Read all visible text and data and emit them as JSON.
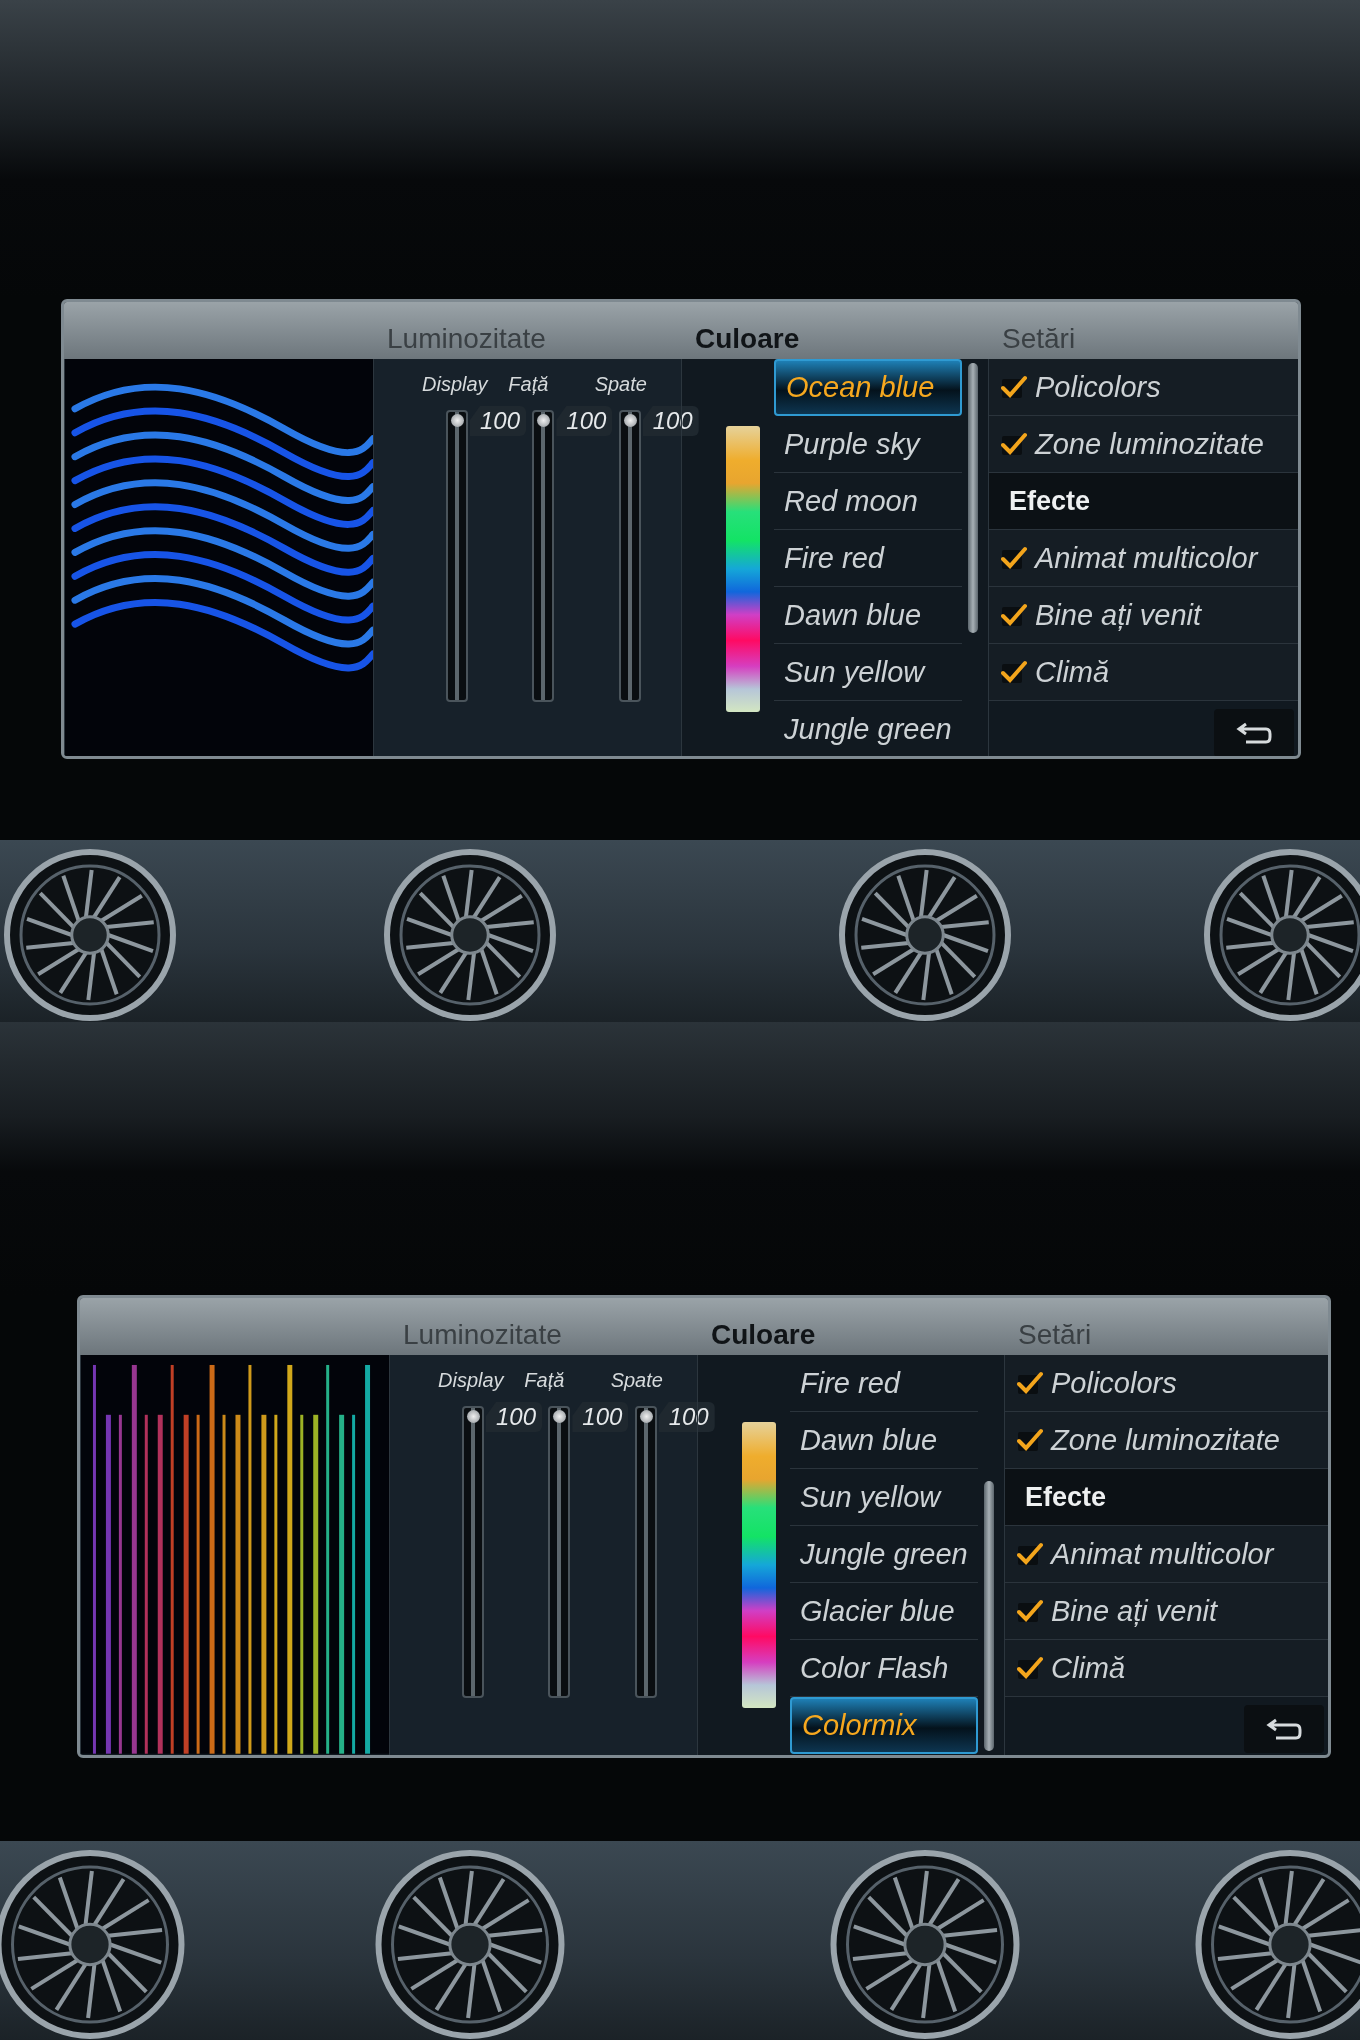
{
  "screens": [
    {
      "kind": "waves",
      "tabs": [
        {
          "label": "Luminozitate",
          "selected": false
        },
        {
          "label": "Culoare",
          "selected": true
        },
        {
          "label": "Setări",
          "selected": false
        }
      ],
      "sliders": [
        {
          "label": "Display",
          "reading": "100",
          "level": 1
        },
        {
          "label": "Față",
          "reading": "100",
          "level": 1
        },
        {
          "label": "Spate",
          "reading": "100",
          "level": 1
        }
      ],
      "colors": [
        {
          "label": "Ocean blue",
          "selected": true
        },
        {
          "label": "Purple sky",
          "selected": false
        },
        {
          "label": "Red moon",
          "selected": false
        },
        {
          "label": "Fire red",
          "selected": false
        },
        {
          "label": "Dawn blue",
          "selected": false
        },
        {
          "label": "Sun yellow",
          "selected": false
        },
        {
          "label": "Jungle green",
          "selected": false
        }
      ],
      "settings": [
        {
          "kind": "check",
          "label": "Policolors",
          "checked": true
        },
        {
          "kind": "check",
          "label": "Zone luminozitate",
          "checked": true
        },
        {
          "kind": "heading",
          "label": "Efecte"
        },
        {
          "kind": "check",
          "label": "Animat multicolor",
          "checked": true
        },
        {
          "kind": "check",
          "label": "Bine ați venit",
          "checked": true
        },
        {
          "kind": "check",
          "label": "Climă",
          "checked": true
        }
      ]
    },
    {
      "kind": "stripes",
      "tabs": [
        {
          "label": "Luminozitate",
          "selected": false
        },
        {
          "label": "Culoare",
          "selected": true
        },
        {
          "label": "Setări",
          "selected": false
        }
      ],
      "sliders": [
        {
          "label": "Display",
          "reading": "100",
          "level": 1
        },
        {
          "label": "Față",
          "reading": "100",
          "level": 1
        },
        {
          "label": "Spate",
          "reading": "100",
          "level": 1
        }
      ],
      "colors": [
        {
          "label": "Fire red",
          "selected": false
        },
        {
          "label": "Dawn blue",
          "selected": false
        },
        {
          "label": "Sun yellow",
          "selected": false
        },
        {
          "label": "Jungle green",
          "selected": false
        },
        {
          "label": "Glacier blue",
          "selected": false
        },
        {
          "label": "Color Flash",
          "selected": false
        },
        {
          "label": "Colormix",
          "selected": true
        }
      ],
      "settings": [
        {
          "kind": "check",
          "label": "Policolors",
          "checked": true
        },
        {
          "kind": "check",
          "label": "Zone luminozitate",
          "checked": true
        },
        {
          "kind": "heading",
          "label": "Efecte"
        },
        {
          "kind": "check",
          "label": "Animat multicolor",
          "checked": true
        },
        {
          "kind": "check",
          "label": "Bine ați venit",
          "checked": true
        },
        {
          "kind": "check",
          "label": "Climă",
          "checked": true
        }
      ]
    }
  ]
}
